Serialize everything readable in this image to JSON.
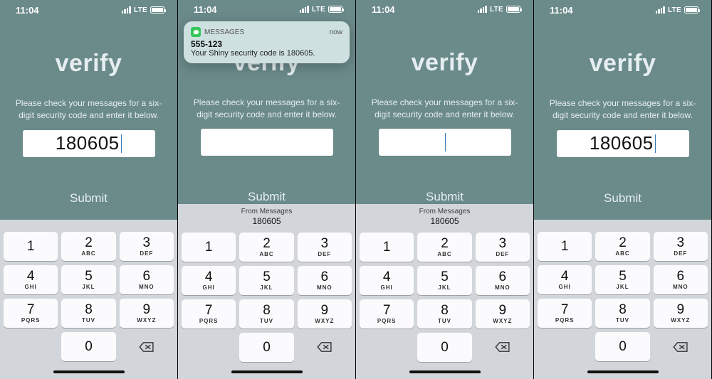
{
  "status": {
    "time": "11:04",
    "carrier_label": "LTE"
  },
  "app": {
    "title": "verify",
    "prompt": "Please check your messages for a six-digit security code and enter it below.",
    "submit_label": "Submit"
  },
  "screens": [
    {
      "code_value": "180605",
      "show_cursor": true,
      "show_keypad_suggestion": false,
      "show_notification": false
    },
    {
      "code_value": "",
      "show_cursor": false,
      "show_keypad_suggestion": true,
      "show_notification": true
    },
    {
      "code_value": "",
      "show_cursor": true,
      "show_keypad_suggestion": true,
      "show_notification": false
    },
    {
      "code_value": "180605",
      "show_cursor": true,
      "show_keypad_suggestion": false,
      "show_notification": false
    }
  ],
  "notification": {
    "app_label": "MESSAGES",
    "timestamp": "now",
    "sender": "555-123",
    "body": "Your Shiny security code is 180605."
  },
  "keypad": {
    "suggestion_from": "From Messages",
    "suggestion_code": "180605",
    "keys": [
      {
        "num": "1",
        "let": ""
      },
      {
        "num": "2",
        "let": "ABC"
      },
      {
        "num": "3",
        "let": "DEF"
      },
      {
        "num": "4",
        "let": "GHI"
      },
      {
        "num": "5",
        "let": "JKL"
      },
      {
        "num": "6",
        "let": "MNO"
      },
      {
        "num": "7",
        "let": "PQRS"
      },
      {
        "num": "8",
        "let": "TUV"
      },
      {
        "num": "9",
        "let": "WXYZ"
      },
      {
        "num": "0",
        "let": ""
      }
    ]
  }
}
